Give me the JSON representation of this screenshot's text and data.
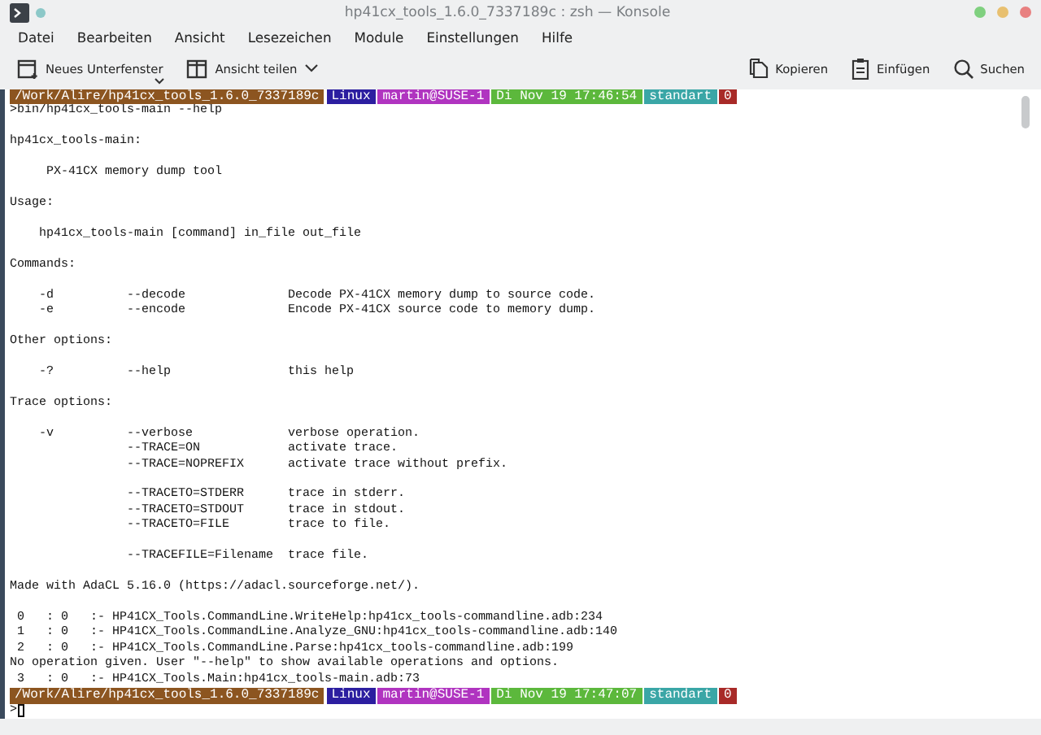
{
  "window": {
    "title": "hp41cx_tools_1.6.0_7337189c : zsh — Konsole"
  },
  "menu": [
    "Datei",
    "Bearbeiten",
    "Ansicht",
    "Lesezeichen",
    "Module",
    "Einstellungen",
    "Hilfe"
  ],
  "toolbar": {
    "left": [
      {
        "kind": "new-tab",
        "label": "Neues Unterfenster"
      },
      {
        "kind": "split",
        "label": "Ansicht teilen"
      }
    ],
    "right": [
      {
        "kind": "copy",
        "label": "Kopieren"
      },
      {
        "kind": "paste",
        "label": "Einfügen"
      },
      {
        "kind": "search",
        "label": "Suchen"
      }
    ]
  },
  "terminal": {
    "lines": [
      {
        "kind": "prompt",
        "segments": [
          {
            "text": "/Work/Alire/hp41cx_tools_1.6.0_7337189c",
            "color": "#8c5520"
          },
          {
            "text": "Linux",
            "color": "#2c1ea0"
          },
          {
            "text": "martin@SUSE-1",
            "color": "#b034c0"
          },
          {
            "text": "Di Nov 19 17:46:54",
            "color": "#5cb83c"
          },
          {
            "text": "standart",
            "color": "#3aa6a6"
          },
          {
            "text": "0",
            "color": "#a82a28"
          }
        ]
      },
      {
        "kind": "text",
        "text": ">bin/hp41cx_tools-main --help"
      },
      {
        "kind": "blank"
      },
      {
        "kind": "text",
        "text": "hp41cx_tools-main:"
      },
      {
        "kind": "blank"
      },
      {
        "kind": "text",
        "text": "     PX-41CX memory dump tool"
      },
      {
        "kind": "blank"
      },
      {
        "kind": "text",
        "text": "Usage:"
      },
      {
        "kind": "blank"
      },
      {
        "kind": "text",
        "text": "    hp41cx_tools-main [command] in_file out_file"
      },
      {
        "kind": "blank"
      },
      {
        "kind": "text",
        "text": "Commands:"
      },
      {
        "kind": "blank"
      },
      {
        "kind": "text",
        "text": "    -d          --decode              Decode PX-41CX memory dump to source code."
      },
      {
        "kind": "text",
        "text": "    -e          --encode              Encode PX-41CX source code to memory dump."
      },
      {
        "kind": "blank"
      },
      {
        "kind": "text",
        "text": "Other options:"
      },
      {
        "kind": "blank"
      },
      {
        "kind": "text",
        "text": "    -?          --help                this help"
      },
      {
        "kind": "blank"
      },
      {
        "kind": "text",
        "text": "Trace options:"
      },
      {
        "kind": "blank"
      },
      {
        "kind": "text",
        "text": "    -v          --verbose             verbose operation."
      },
      {
        "kind": "text",
        "text": "                --TRACE=ON            activate trace."
      },
      {
        "kind": "text",
        "text": "                --TRACE=NOPREFIX      activate trace without prefix."
      },
      {
        "kind": "blank"
      },
      {
        "kind": "text",
        "text": "                --TRACETO=STDERR      trace in stderr."
      },
      {
        "kind": "text",
        "text": "                --TRACETO=STDOUT      trace in stdout."
      },
      {
        "kind": "text",
        "text": "                --TRACETO=FILE        trace to file."
      },
      {
        "kind": "blank"
      },
      {
        "kind": "text",
        "text": "                --TRACEFILE=Filename  trace file."
      },
      {
        "kind": "blank"
      },
      {
        "kind": "text",
        "text": "Made with AdaCL 5.16.0 (https://adacl.sourceforge.net/)."
      },
      {
        "kind": "blank"
      },
      {
        "kind": "text",
        "text": " 0   : 0   :- HP41CX_Tools.CommandLine.WriteHelp:hp41cx_tools-commandline.adb:234"
      },
      {
        "kind": "text",
        "text": " 1   : 0   :- HP41CX_Tools.CommandLine.Analyze_GNU:hp41cx_tools-commandline.adb:140"
      },
      {
        "kind": "text",
        "text": " 2   : 0   :- HP41CX_Tools.CommandLine.Parse:hp41cx_tools-commandline.adb:199"
      },
      {
        "kind": "text",
        "text": "No operation given. User \"--help\" to show available operations and options."
      },
      {
        "kind": "text",
        "text": " 3   : 0   :- HP41CX_Tools.Main:hp41cx_tools-main.adb:73"
      },
      {
        "kind": "prompt",
        "segments": [
          {
            "text": "/Work/Alire/hp41cx_tools_1.6.0_7337189c",
            "color": "#8c5520"
          },
          {
            "text": "Linux",
            "color": "#2c1ea0"
          },
          {
            "text": "martin@SUSE-1",
            "color": "#b034c0"
          },
          {
            "text": "Di Nov 19 17:47:07",
            "color": "#5cb83c"
          },
          {
            "text": "standart",
            "color": "#3aa6a6"
          },
          {
            "text": "0",
            "color": "#a82a28"
          }
        ]
      },
      {
        "kind": "input",
        "text": ">"
      }
    ]
  }
}
